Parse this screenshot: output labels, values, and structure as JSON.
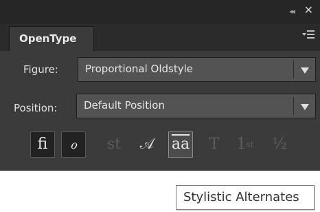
{
  "window": {
    "collapse_glyph": "◂◂",
    "close_glyph": "✕"
  },
  "panel": {
    "tab_label": "OpenType",
    "menu_icon": "panel-menu-icon"
  },
  "figure": {
    "label": "Figure:",
    "value": "Proportional Oldstyle"
  },
  "position": {
    "label": "Position:",
    "value": "Default Position"
  },
  "glyph_buttons": [
    {
      "name": "standard-ligatures-button",
      "glyph": "fi",
      "state": "on"
    },
    {
      "name": "contextual-alternates-button",
      "glyph": "ℴ",
      "state": "on"
    },
    {
      "name": "discretionary-ligatures-button",
      "glyph": "st",
      "state": "disabled"
    },
    {
      "name": "swash-button",
      "glyph": "𝒜",
      "state": "enabled"
    },
    {
      "name": "stylistic-alternates-button",
      "glyph": "aa",
      "state": "hover"
    },
    {
      "name": "titling-alternates-button",
      "glyph": "T",
      "state": "disabled"
    },
    {
      "name": "ordinals-button",
      "glyph": "1",
      "sup": "st",
      "state": "disabled"
    },
    {
      "name": "fractions-button",
      "glyph": "½",
      "state": "disabled"
    }
  ],
  "tooltip": {
    "text": "Stylistic Alternates"
  }
}
